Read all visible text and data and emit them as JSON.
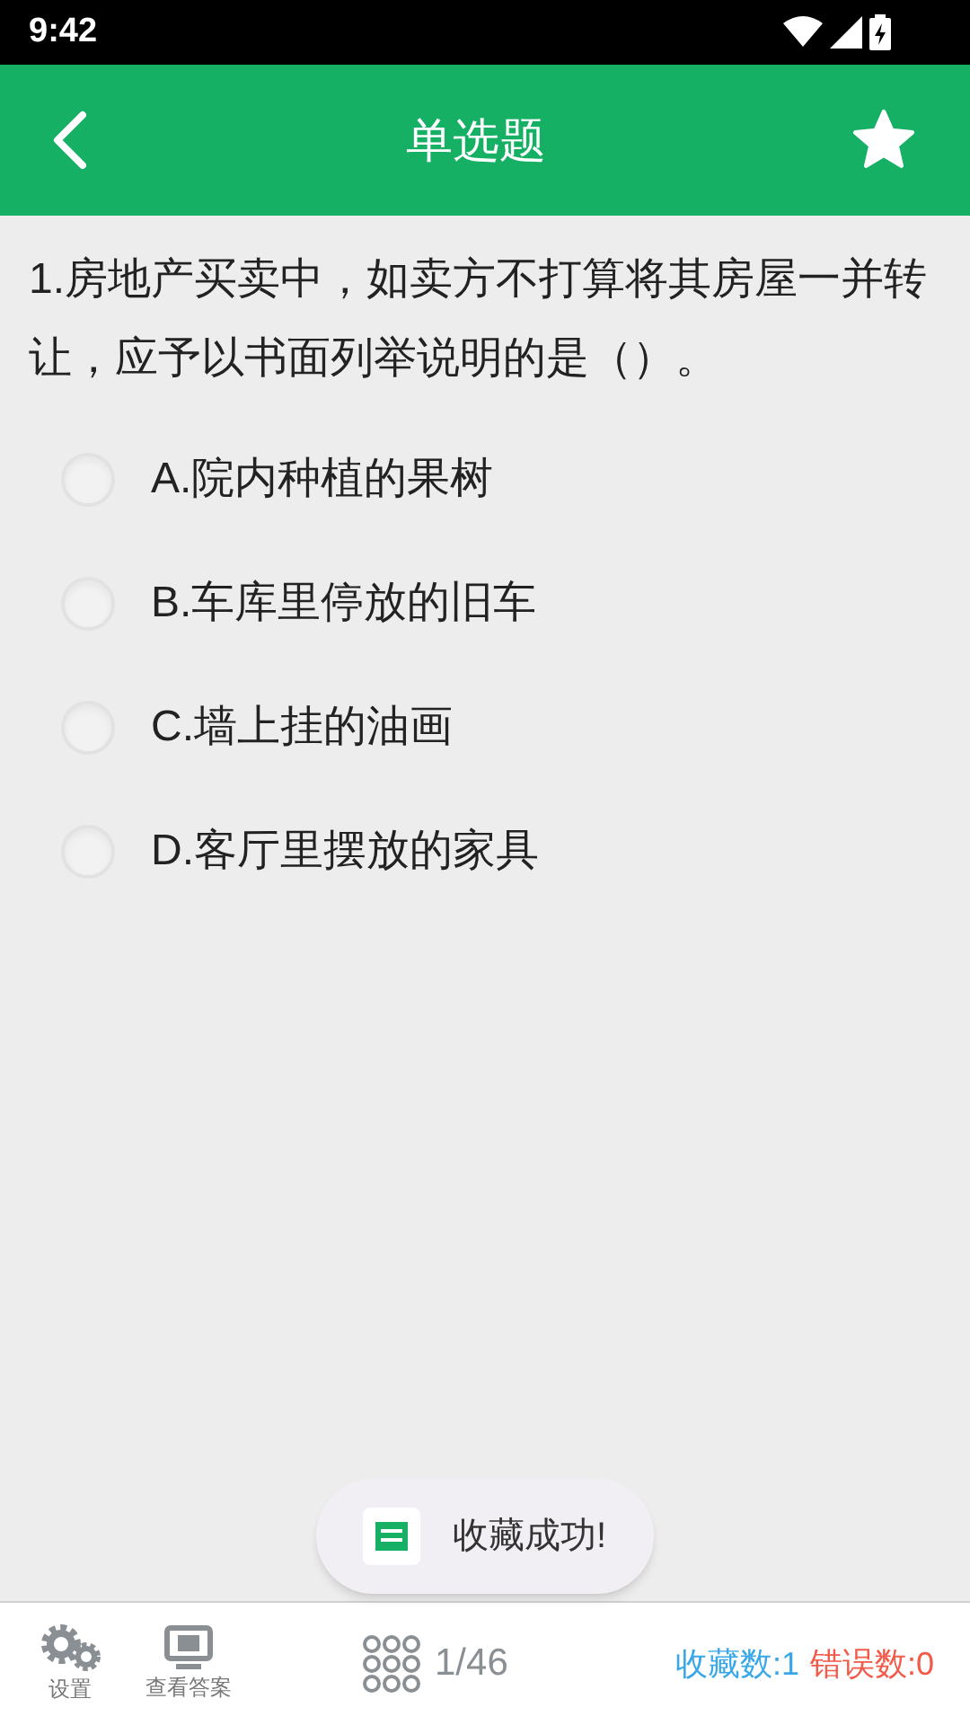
{
  "status_bar": {
    "time": "9:42"
  },
  "header": {
    "title": "单选题",
    "favorited": true
  },
  "question": {
    "text": "1.房地产买卖中，如卖方不打算将其房屋一并转让，应予以书面列举说明的是（）。"
  },
  "options": [
    {
      "label": "A.院内种植的果树",
      "selected": false
    },
    {
      "label": "B.车库里停放的旧车",
      "selected": false
    },
    {
      "label": "C.墙上挂的油画",
      "selected": false
    },
    {
      "label": "D.客厅里摆放的家具",
      "selected": false
    }
  ],
  "toast": {
    "text": "收藏成功!"
  },
  "bottom_bar": {
    "settings": "设置",
    "view_answer": "查看答案",
    "progress": "1/46",
    "favorites": "收藏数:1",
    "errors": "错误数:0"
  }
}
